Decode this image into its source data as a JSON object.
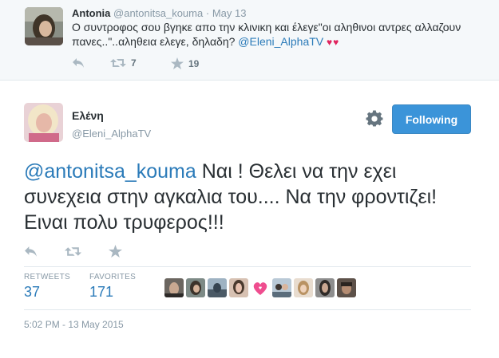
{
  "parent_tweet": {
    "name": "Antonia",
    "handle": "@antonitsa_kouma",
    "separator": "·",
    "time": "May 13",
    "text_main": "Ο συντροφος σου βγηκε απο την κλινικη και έλεγε\"οι αληθινοι αντρες αλλαζουν πανες..\"..αληθεια ελεγε, δηλαδη?",
    "text_mention": "@Eleni_AlphaTV",
    "hearts": "♥♥",
    "retweet_count": "7",
    "favorite_count": "19"
  },
  "tweet": {
    "name": "Ελένη",
    "handle": "@Eleni_AlphaTV",
    "follow_button": "Following",
    "text_mention": "@antonitsa_kouma",
    "text_body": " Ναι ! Θελει να την εχει συνεχεια στην αγκαλια του.... Να την φροντιζει! Ειναι πολυ τρυφερος!!!",
    "retweets_label": "RETWEETS",
    "retweets_value": "37",
    "favorites_label": "FAVORITES",
    "favorites_value": "171",
    "timestamp": "5:02 PM - 13 May 2015"
  },
  "icons": {
    "reply": "reply-icon",
    "retweet": "retweet-icon",
    "favorite": "star-icon",
    "settings": "gear-icon"
  },
  "colors": {
    "link": "#2b7bb9",
    "follow_button_bg": "#3b94d9",
    "muted": "#8899a6",
    "hearts": "#e0245e"
  }
}
